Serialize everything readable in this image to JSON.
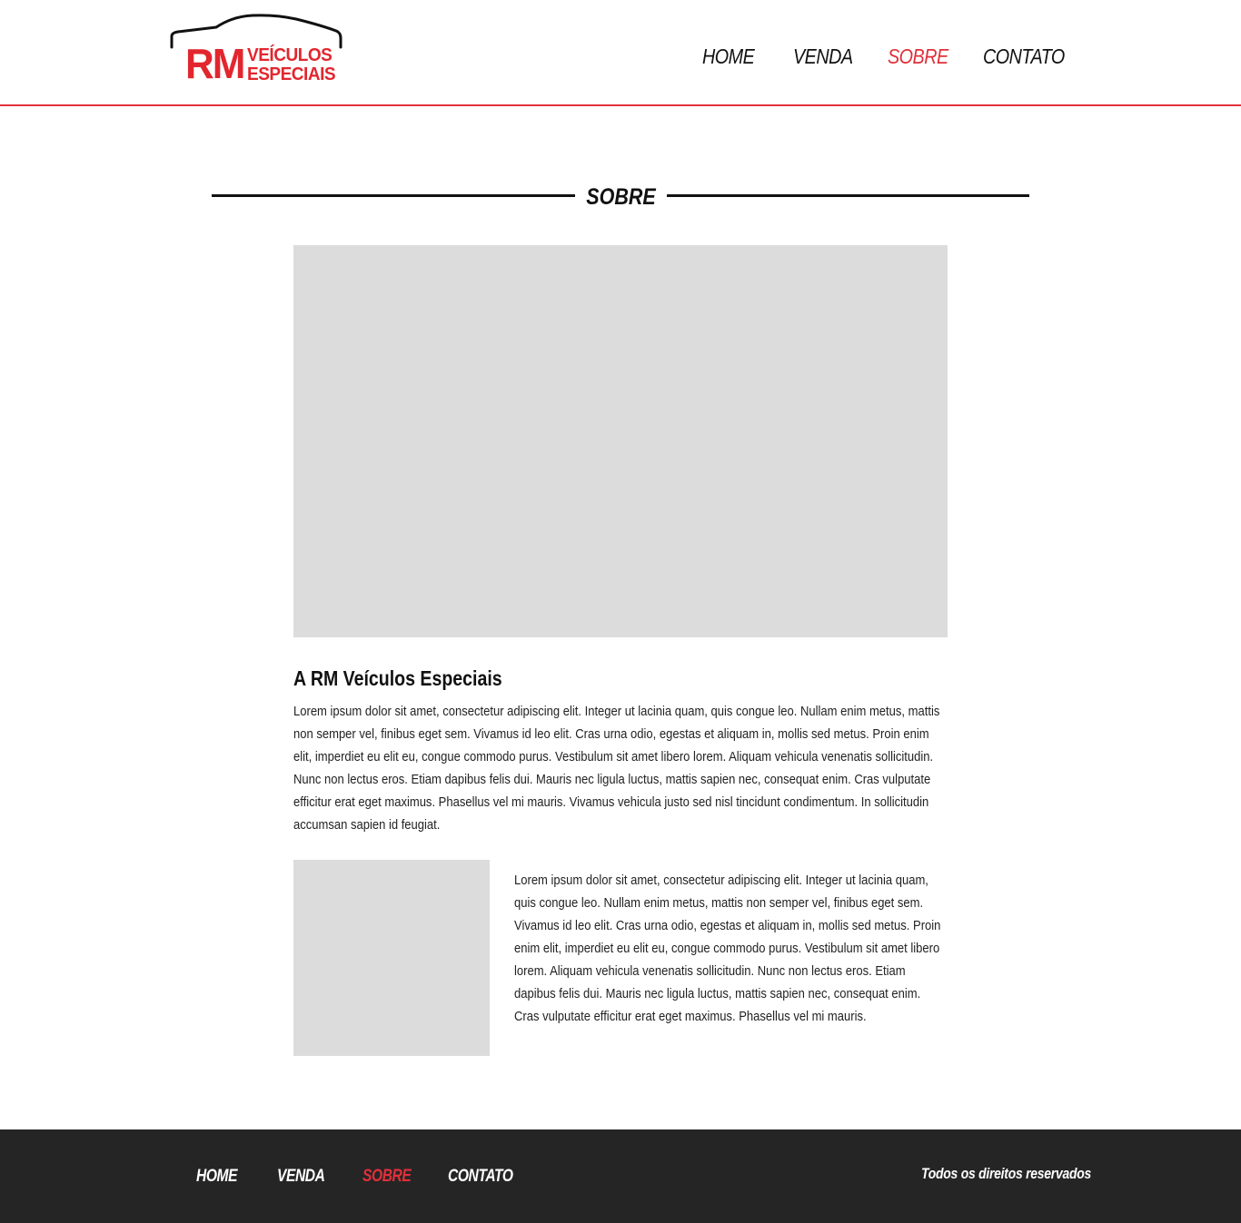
{
  "brand": {
    "initials": "RM",
    "line1": "VEÍCULOS",
    "line2": "ESPECIAIS",
    "color": "#e2262e"
  },
  "nav": {
    "items": [
      {
        "label": "HOME",
        "active": false
      },
      {
        "label": "VENDA",
        "active": false
      },
      {
        "label": "SOBRE",
        "active": true
      },
      {
        "label": "CONTATO",
        "active": false
      }
    ],
    "active_color": "#e0303a"
  },
  "section": {
    "title": "SOBRE"
  },
  "about": {
    "heading": "A RM Veículos Especiais",
    "paragraph1": "Lorem ipsum dolor sit amet, consectetur adipiscing elit. Integer ut lacinia quam, quis congue leo. Nullam enim metus, mattis non semper vel, finibus eget sem. Vivamus id leo elit. Cras urna odio, egestas et aliquam in, mollis sed metus. Proin enim elit, imperdiet eu elit eu, congue commodo purus. Vestibulum sit amet libero lorem. Aliquam vehicula venenatis sollicitudin. Nunc non lectus eros. Etiam dapibus felis dui. Mauris nec ligula luctus, mattis sapien nec, consequat enim. Cras vulputate efficitur erat eget maximus. Phasellus vel mi mauris. Vivamus vehicula justo sed nisl tincidunt condimentum. In sollicitudin accumsan sapien id feugiat.",
    "paragraph2": "Lorem ipsum dolor sit amet, consectetur adipiscing elit. Integer ut lacinia quam, quis congue leo. Nullam enim metus, mattis non semper vel, finibus eget sem. Vivamus id leo elit. Cras urna odio, egestas et aliquam in, mollis sed metus. Proin enim elit, imperdiet eu elit eu, congue commodo purus. Vestibulum sit amet libero lorem. Aliquam vehicula venenatis sollicitudin. Nunc non lectus eros. Etiam dapibus felis dui. Mauris nec ligula luctus, mattis sapien nec, consequat enim. Cras vulputate efficitur erat eget maximus. Phasellus vel mi mauris."
  },
  "footer": {
    "nav": [
      {
        "label": "HOME",
        "active": false
      },
      {
        "label": "VENDA",
        "active": false
      },
      {
        "label": "SOBRE",
        "active": true
      },
      {
        "label": "CONTATO",
        "active": false
      }
    ],
    "rights": "Todos os direitos reservados",
    "background": "#252525"
  }
}
